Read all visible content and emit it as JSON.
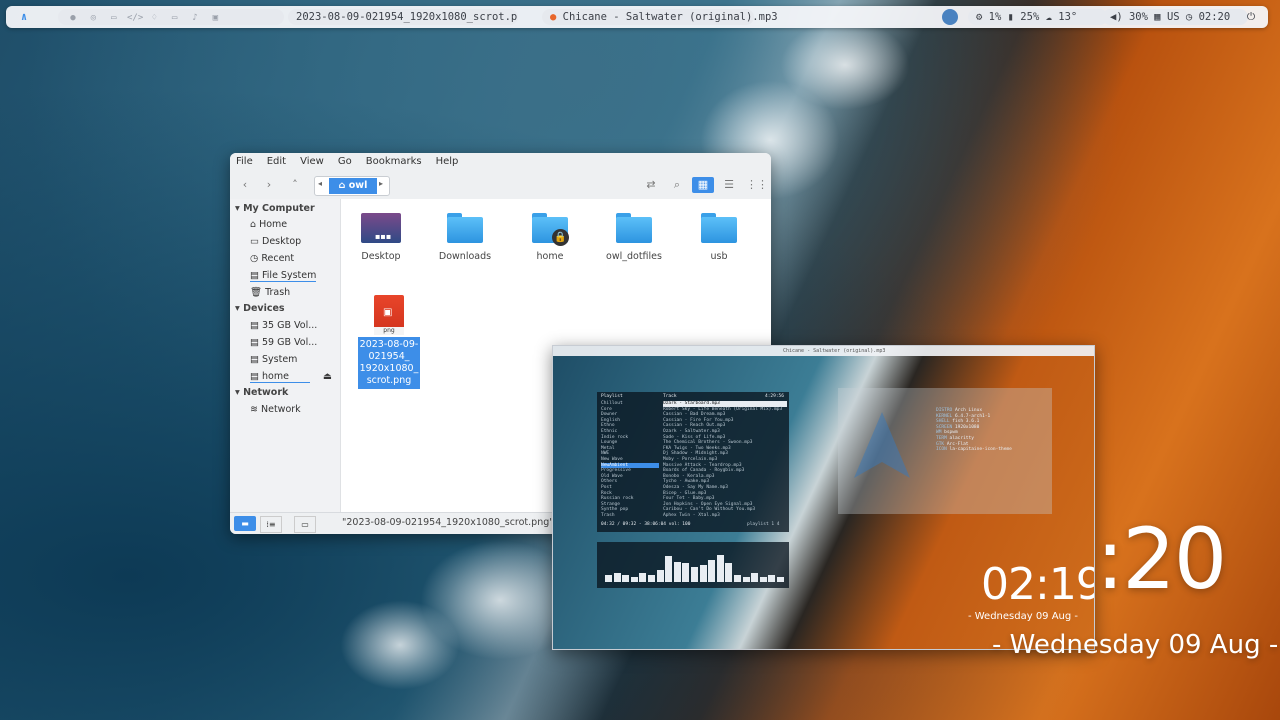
{
  "topbar": {
    "window_title": "2023-08-09-021954_1920x1080_scrot.png...",
    "now_playing": "Chicane - Saltwater (original).mp3",
    "cpu": "1%",
    "memory": "25%",
    "weather": "13°",
    "volume": "30%",
    "keyboard": "US",
    "time": "02:20"
  },
  "file_manager": {
    "menu": [
      "File",
      "Edit",
      "View",
      "Go",
      "Bookmarks",
      "Help"
    ],
    "breadcrumb": "owl",
    "sidebar": {
      "my_computer": "My Computer",
      "places": [
        "Home",
        "Desktop",
        "Recent",
        "File System",
        "Trash"
      ],
      "devices_header": "Devices",
      "devices": [
        "35 GB Vol...",
        "59 GB Vol...",
        "System",
        "home"
      ],
      "network_header": "Network",
      "network": [
        "Network"
      ]
    },
    "items": [
      "Desktop",
      "Downloads",
      "home",
      "owl_dotfiles",
      "usb"
    ],
    "selected_file": {
      "ext": "png",
      "name_lines": [
        "2023-08-09-",
        "021954_",
        "1920x1080_",
        "scrot.png"
      ]
    },
    "status": "\"2023-08-09-021954_1920x1080_scrot.png\" se"
  },
  "terminal_window": {
    "title": "Chicane - Saltwater (original).mp3",
    "music_header_left": "Playlist",
    "music_header_mid": "Track",
    "music_header_right": "4:29:56",
    "genres": [
      "Chillout",
      "Core",
      "Downer",
      "English",
      "Ethno",
      "Ethnic",
      "Indie rock",
      "Lounge",
      "Metal",
      "NWE",
      "New Wave",
      "NewAmbient",
      "Progressive",
      "Old Wave",
      "Others",
      "Post",
      "Rock",
      "Russian rock",
      "Strange",
      "Synthe pop",
      "Trash"
    ],
    "tracks": [
      "Ozark - Starboard.mp3",
      "Robert Sky - Life Beneath (Original Mix).mp3",
      "Cassian - Bad Dream.mp3",
      "Cassian - Fire For You.mp3",
      "Cassian - Reach Out.mp3",
      "Ozark - Saltwater.mp3",
      "Sade - Kiss of Life.mp3",
      "The Chemical Brothers - Swoon.mp3",
      "FKA Twigs - Two Weeks.mp3",
      "Dj Shadow - Midnight.mp3",
      "Moby - Porcelain.mp3",
      "Massive Attack - Teardrop.mp3",
      "Boards of Canada - Roygbiv.mp3",
      "Bonobo - Kerala.mp3",
      "Tycho - Awake.mp3",
      "Odesza - Say My Name.mp3",
      "Bicep - Glue.mp3",
      "Four Tet - Baby.mp3",
      "Jon Hopkins - Open Eye Signal.mp3",
      "Caribou - Can't Do Without You.mp3",
      "Aphex Twin - Xtal.mp3"
    ],
    "playback": "04:32 / 09:32 - 38:06:04 vol: 100",
    "playlist_label": "playlist 1 4",
    "neofetch": [
      {
        "k": "DISTRO",
        "v": "Arch Linux"
      },
      {
        "k": "KERNEL",
        "v": "6.4.7-arch1-1"
      },
      {
        "k": "SHELL",
        "v": "fish 3.6.1"
      },
      {
        "k": "SCREEN",
        "v": "1920x1080"
      },
      {
        "k": "WM",
        "v": "bspwm"
      },
      {
        "k": "TERM",
        "v": "alacritty"
      },
      {
        "k": "GTK",
        "v": "Arc-Flat"
      },
      {
        "k": "ICON",
        "v": "la-capitaine-icon-theme"
      }
    ],
    "small_clock": "02:19",
    "small_date": "- Wednesday 09 Aug -"
  },
  "desktop_clock": {
    "time": ":20",
    "date": "Wednesday 09 Aug"
  },
  "visualizer_levels": [
    0.2,
    0.25,
    0.2,
    0.15,
    0.25,
    0.2,
    0.35,
    0.75,
    0.6,
    0.55,
    0.45,
    0.5,
    0.65,
    0.8,
    0.55,
    0.2,
    0.15,
    0.25,
    0.15,
    0.2,
    0.15
  ],
  "colors": {
    "accent": "#3d8ee8",
    "topbar_bg": "#f5f7fa"
  }
}
